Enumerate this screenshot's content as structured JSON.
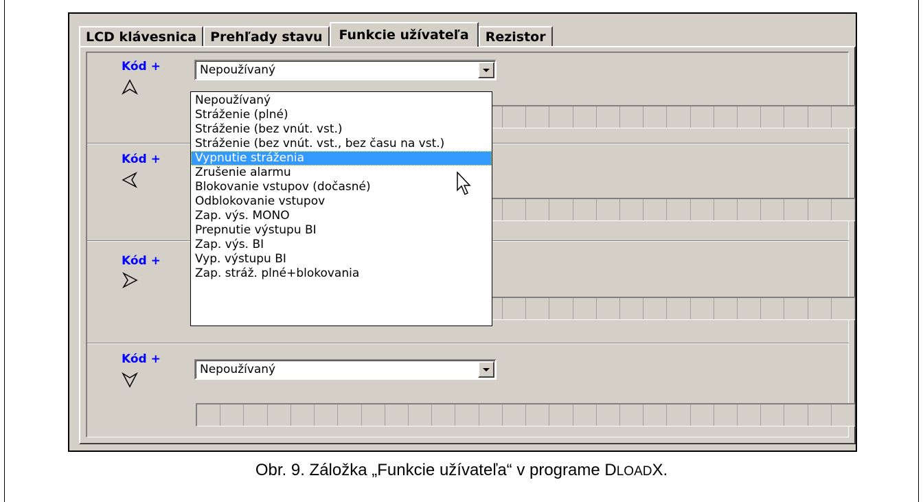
{
  "tabs": [
    {
      "label": "LCD klávesnica"
    },
    {
      "label": "Prehľady stavu"
    },
    {
      "label": "Funkcie užívateľa",
      "active": true
    },
    {
      "label": "Rezistor"
    }
  ],
  "sections": [
    {
      "label": "Kód +",
      "arrow": "up-arrow-icon",
      "value": "Nepoužívaný"
    },
    {
      "label": "Kód +",
      "arrow": "left-arrow-icon",
      "value": ""
    },
    {
      "label": "Kód +",
      "arrow": "right-arrow-icon",
      "value": ""
    },
    {
      "label": "Kód +",
      "arrow": "down-arrow-icon",
      "value": "Nepoužívaný"
    }
  ],
  "dropdown": {
    "options": [
      "Nepoužívaný",
      "Stráženie (plné)",
      "Stráženie (bez vnút. vst.)",
      "Stráženie (bez vnút. vst., bez času na vst.)",
      "Vypnutie stráženia",
      "Zrušenie alarmu",
      "Blokovanie vstupov (dočasné)",
      "Odblokovanie vstupov",
      "Zap. výs. MONO",
      "Prepnutie výstupu BI",
      "Zap. výs. BI",
      "Vyp. výstupu BI",
      "Zap. stráž. plné+blokovania"
    ],
    "selected_index": 4
  },
  "caption": {
    "prefix": "Obr. 9. Záložka „Funkcie užívateľa“ v programe D",
    "smallcaps": "LOAD",
    "suffix": "X."
  },
  "colors": {
    "window_bg": "#d4d0c8",
    "label_blue": "#0000ff",
    "highlight": "#3399ff"
  }
}
